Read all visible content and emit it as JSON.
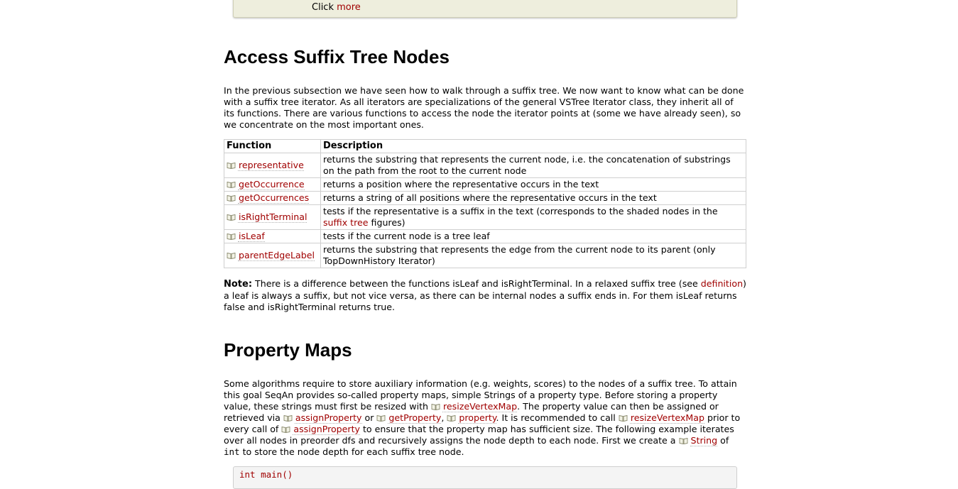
{
  "top_box": {
    "text": "Click ",
    "link": "more"
  },
  "section1": {
    "title": "Access Suffix Tree Nodes",
    "intro": "In the previous subsection we have seen how to walk through a suffix tree. We now want to know what can be done with a suffix tree iterator. As all iterators are specializations of the general VSTree Iterator class, they inherit all of its functions. There are various functions to access the node the iterator points at (some we have already seen), so we concentrate on the most important ones.",
    "table": {
      "headers": [
        "Function",
        "Description"
      ],
      "rows": [
        {
          "fn": "representative",
          "desc": "returns the substring that represents the current node, i.e. the concatenation of substrings on the path from the root to the current node"
        },
        {
          "fn": "getOccurrence",
          "desc": "returns a position where the representative occurs in the text"
        },
        {
          "fn": "getOccurrences",
          "desc": "returns a string of all positions where the representative occurs in the text"
        },
        {
          "fn": "isRightTerminal",
          "desc_a": "tests if the representative is a suffix in the text (corresponds to the shaded nodes in the ",
          "desc_link": "suffix tree",
          "desc_b": " figures)"
        },
        {
          "fn": "isLeaf",
          "desc": "tests if the current node is a tree leaf"
        },
        {
          "fn": "parentEdgeLabel",
          "desc": "returns the substring that represents the edge from the current node to its parent (only TopDownHistory Iterator)"
        }
      ]
    },
    "note": {
      "label": "Note:",
      "text_a": " There is a difference between the functions isLeaf and isRightTerminal. In a relaxed suffix tree (see ",
      "link": "definition",
      "text_b": ") a leaf is always a suffix, but not vice versa, as there can be internal nodes a suffix ends in. For them isLeaf returns false and isRightTerminal returns true."
    }
  },
  "section2": {
    "title": "Property Maps",
    "p1": "Some algorithms require to store auxiliary information (e.g. weights, scores) to the nodes of a suffix tree. To attain this goal SeqAn provides so-called property maps, simple Strings of a property type. Before storing a property value, these strings must first be resized with ",
    "link_resize": "resizeVertexMap",
    "p2": ". The property value can then be assigned or retrieved via ",
    "link_assign": "assignProperty",
    "p3": " or ",
    "link_get": "getProperty",
    "p4": ", ",
    "link_property": "property",
    "p5": ". It is recommended to call ",
    "p6": " prior to every call of ",
    "p7": " to ensure that the property map has sufficient size. The following example iterates over all nodes in preorder dfs and recursively assigns the node depth to each node. First we create a ",
    "link_string": "String",
    "p8": " of ",
    "code_int": "int",
    "p9": " to store the node depth for each suffix tree node."
  },
  "code_box": {
    "text": "int main()"
  },
  "icons": {
    "doc_link": "book-icon"
  },
  "colors": {
    "link": "#a00000",
    "box_bg": "#eeeedd"
  }
}
